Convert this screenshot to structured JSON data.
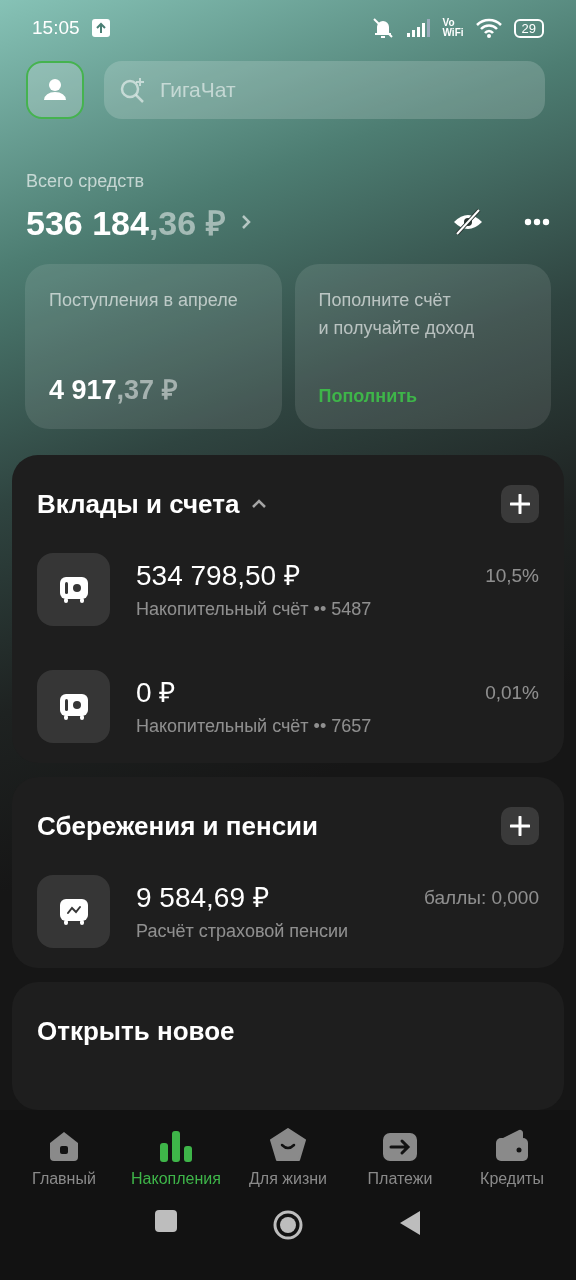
{
  "status_bar": {
    "time": "15:05",
    "volte": "Vo\nWiFi",
    "battery": "29"
  },
  "search": {
    "placeholder": "ГигаЧат"
  },
  "total": {
    "label": "Всего средств",
    "whole": "536 184",
    "fraction": ",36 ₽"
  },
  "summary_cards": [
    {
      "kind": "amount",
      "title": "Поступления в апреле",
      "whole": "4 917",
      "fraction": ",37 ₽"
    },
    {
      "kind": "promo",
      "title": "Пополните счёт\nи получайте доход",
      "action": "Пополнить"
    }
  ],
  "sections": [
    {
      "title": "Вклады и счета",
      "expanded": true,
      "items": [
        {
          "kind": "safe",
          "amount": "534 798,50 ₽",
          "subtitle": "Накопительный счёт •• 5487",
          "rate": "10,5%"
        },
        {
          "kind": "safe",
          "amount": "0 ₽",
          "subtitle": "Накопительный счёт •• 7657",
          "rate": "0,01%"
        }
      ]
    },
    {
      "title": "Сбережения и пенсии",
      "items": [
        {
          "kind": "pension",
          "amount": "9 584,69 ₽",
          "subtitle": "Расчёт страховой пенсии",
          "rate": "баллы: 0,000"
        }
      ]
    },
    {
      "title": "Открыть новое"
    }
  ],
  "nav": [
    {
      "kind": "home",
      "label": "Главный",
      "selected": false
    },
    {
      "kind": "savings",
      "label": "Накопления",
      "selected": true
    },
    {
      "kind": "life",
      "label": "Для жизни",
      "selected": false
    },
    {
      "kind": "payments",
      "label": "Платежи",
      "selected": false
    },
    {
      "kind": "credits",
      "label": "Кредиты",
      "selected": false
    }
  ]
}
